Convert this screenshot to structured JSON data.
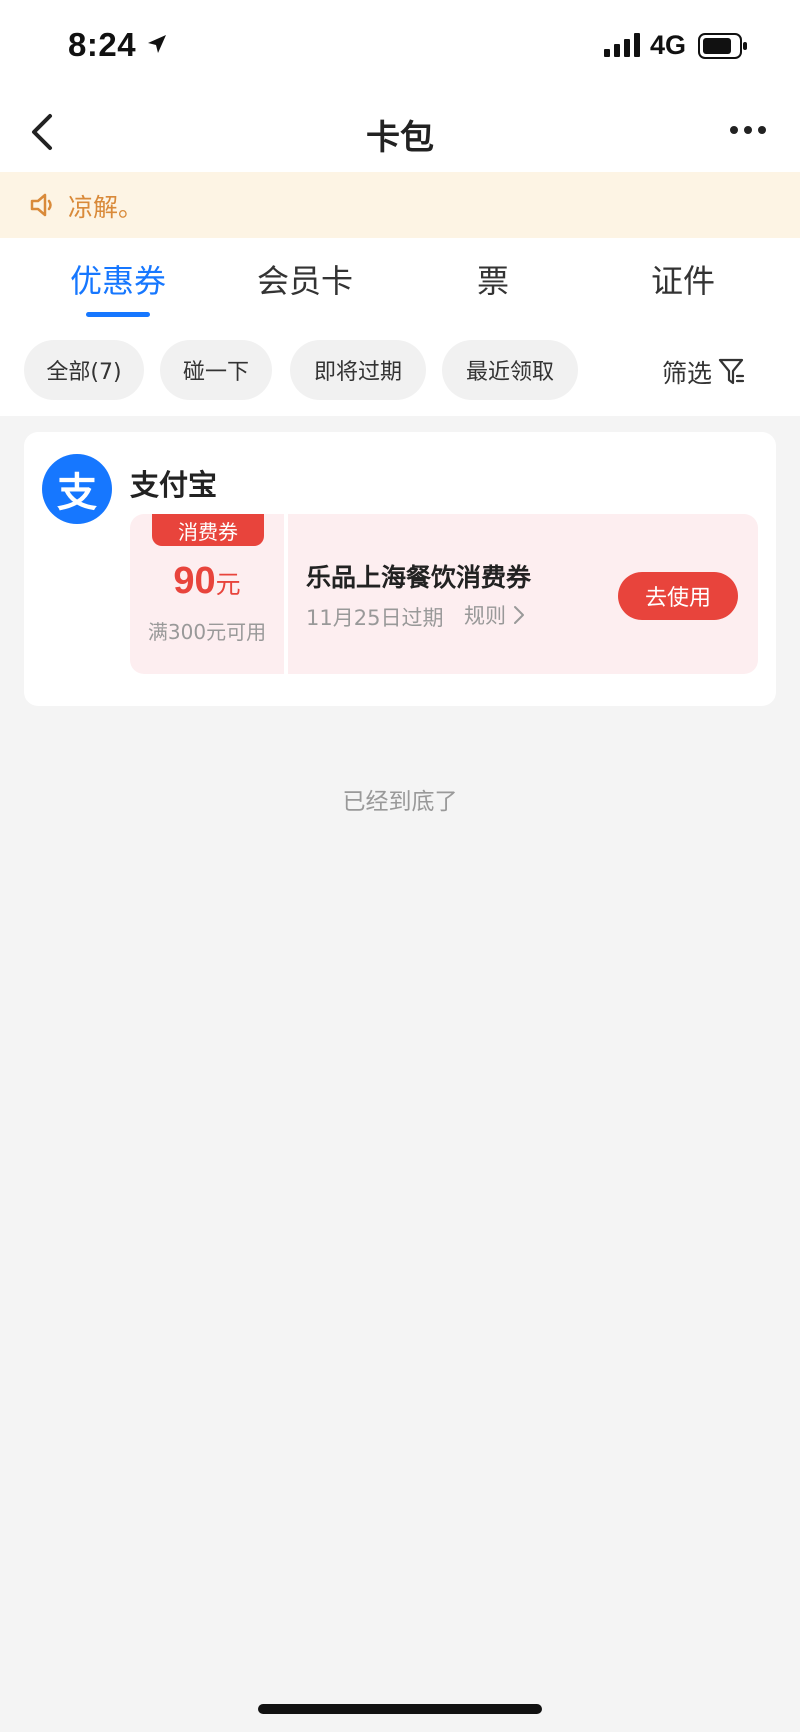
{
  "status_bar": {
    "time": "8:24",
    "network": "4G",
    "icons": [
      "location-arrow-icon",
      "signal-icon",
      "battery-icon"
    ]
  },
  "nav": {
    "title": "卡包",
    "icons": [
      "back-icon",
      "more-icon"
    ]
  },
  "notice": {
    "text": "凉解。",
    "icon": "speaker-icon"
  },
  "tabs": [
    {
      "label": "优惠券",
      "active": true
    },
    {
      "label": "会员卡",
      "active": false
    },
    {
      "label": "票",
      "active": false
    },
    {
      "label": "证件",
      "active": false
    }
  ],
  "filters": {
    "chips": [
      "全部(7)",
      "碰一下",
      "即将过期",
      "最近领取"
    ],
    "filter_label": "筛选"
  },
  "card": {
    "brand": "支付宝",
    "brand_logo_glyph": "支",
    "coupon": {
      "tag": "消费券",
      "amount": "90",
      "unit": "元",
      "condition": "满300元可用",
      "title": "乐品上海餐饮消费券",
      "expiry": "11月25日过期",
      "rules_label": "规则",
      "use_button": "去使用"
    }
  },
  "end_text": "已经到底了",
  "colors": {
    "accent_blue": "#1677ff",
    "coupon_red": "#e8443c",
    "coupon_bg": "#fdeef0",
    "notice_bg": "#fdf4e4",
    "notice_text": "#d98a3a"
  }
}
